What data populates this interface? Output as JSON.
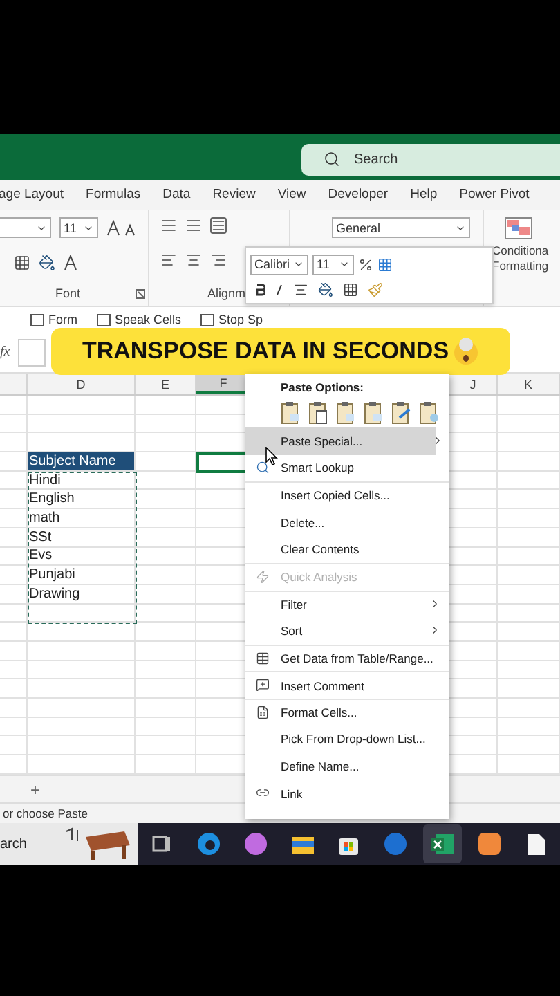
{
  "title_bar": {
    "search": {
      "placeholder": "Search"
    }
  },
  "ribbon_tabs": [
    {
      "label": "age Layout",
      "selected": false
    },
    {
      "label": "Formulas",
      "selected": false
    },
    {
      "label": "Data",
      "selected": false
    },
    {
      "label": "Review",
      "selected": false
    },
    {
      "label": "View",
      "selected": false
    },
    {
      "label": "Developer",
      "selected": false
    },
    {
      "label": "Help",
      "selected": false
    },
    {
      "label": "Power Pivot",
      "selected": false
    }
  ],
  "ribbon": {
    "font_size": "11",
    "font_group_label": "Font",
    "alignment_group_label": "Alignm",
    "number_format": "General",
    "conditional_formatting": [
      "Conditiona",
      "Formatting"
    ]
  },
  "quick_access": [
    "Form",
    "Speak Cells",
    "Stop Sp"
  ],
  "mini_toolbar": {
    "font": "Calibri",
    "size": "11"
  },
  "formula_bar": {
    "fx": "fx"
  },
  "caption": "TRANSPOSE DATA IN SECONDS",
  "columns_left": [
    {
      "label": "D",
      "selected": false
    },
    {
      "label": "E",
      "selected": false
    },
    {
      "label": "F",
      "selected": true
    }
  ],
  "columns_right": [
    {
      "label": "J",
      "selected": false
    },
    {
      "label": "K",
      "selected": false
    }
  ],
  "data": {
    "header": "Subject Name",
    "items": [
      "Hindi",
      "English",
      "math",
      "SSt",
      "Evs",
      "Punjabi",
      "Drawing"
    ]
  },
  "context_menu": {
    "title": "Paste Options:",
    "items": [
      {
        "label": "Paste Special...",
        "kind": "submenu",
        "selected": true,
        "disabled": false,
        "separator_before": false
      },
      {
        "label": "Smart Lookup",
        "kind": "item",
        "selected": false,
        "disabled": false,
        "separator_before": false
      },
      {
        "label": "Insert Copied Cells...",
        "kind": "item",
        "selected": false,
        "disabled": false,
        "separator_before": true
      },
      {
        "label": "Delete...",
        "kind": "item",
        "selected": false,
        "disabled": false,
        "separator_before": false
      },
      {
        "label": "Clear Contents",
        "kind": "item",
        "selected": false,
        "disabled": false,
        "separator_before": false
      },
      {
        "label": "Quick Analysis",
        "kind": "item",
        "selected": false,
        "disabled": true,
        "separator_before": true
      },
      {
        "label": "Filter",
        "kind": "submenu",
        "selected": false,
        "disabled": false,
        "separator_before": true
      },
      {
        "label": "Sort",
        "kind": "submenu",
        "selected": false,
        "disabled": false,
        "separator_before": false
      },
      {
        "label": "Get Data from Table/Range...",
        "kind": "item",
        "selected": false,
        "disabled": false,
        "separator_before": true
      },
      {
        "label": "Insert Comment",
        "kind": "item",
        "selected": false,
        "disabled": false,
        "separator_before": true
      },
      {
        "label": "Format Cells...",
        "kind": "item",
        "selected": false,
        "disabled": false,
        "separator_before": true
      },
      {
        "label": "Pick From Drop-down List...",
        "kind": "item",
        "selected": false,
        "disabled": false,
        "separator_before": false
      },
      {
        "label": "Define Name...",
        "kind": "item",
        "selected": false,
        "disabled": false,
        "separator_before": false
      },
      {
        "label": "Link",
        "kind": "item",
        "selected": false,
        "disabled": false,
        "separator_before": false
      }
    ]
  },
  "sheet_bar": {
    "add": "+"
  },
  "status_bar": "or choose Paste",
  "taskbar": {
    "search": "arch",
    "apps": [
      {
        "selected": false
      },
      {
        "selected": false
      },
      {
        "selected": false
      },
      {
        "selected": false
      },
      {
        "selected": false
      },
      {
        "selected": false
      },
      {
        "selected": true
      },
      {
        "selected": false
      },
      {
        "selected": false
      }
    ]
  }
}
